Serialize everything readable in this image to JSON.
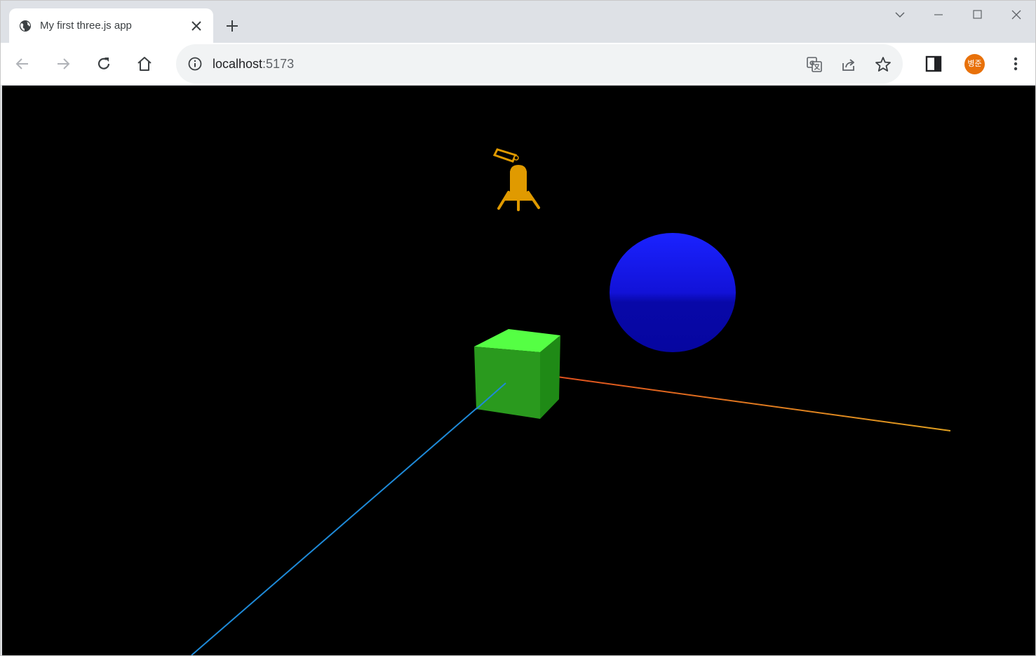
{
  "tab": {
    "title": "My first three.js app",
    "favicon": "globe-icon"
  },
  "address_bar": {
    "host": "localhost",
    "port": ":5173"
  },
  "profile": {
    "initials": "병준",
    "color": "#e8710a"
  },
  "scene": {
    "background": "#000000",
    "axes": {
      "x_color": "#e07a18",
      "y_color": "#6cc420",
      "z_color": "#1e8ad8"
    },
    "cube_color": "#2a9a1e",
    "sphere_color": "#1010e0",
    "light_helper_color": "#e09a00"
  },
  "icons": [
    "globe-icon",
    "close-icon",
    "plus-icon",
    "chevron-down-icon",
    "minimize-icon",
    "maximize-icon",
    "window-close-icon",
    "back-arrow-icon",
    "forward-arrow-icon",
    "reload-icon",
    "home-icon",
    "info-icon",
    "translate-icon",
    "share-icon",
    "star-icon",
    "side-panel-icon",
    "kebab-menu-icon"
  ]
}
